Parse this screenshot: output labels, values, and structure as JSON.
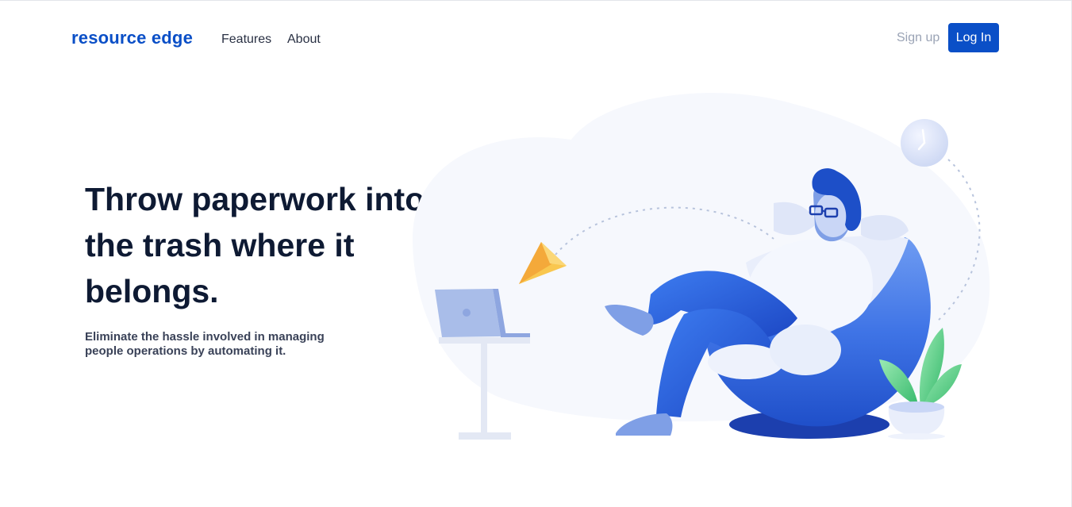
{
  "nav": {
    "brand": "resource edge",
    "links": [
      "Features",
      "About"
    ],
    "signup_label": "Sign up",
    "login_label": "Log In"
  },
  "hero": {
    "title": "Throw paperwork into the trash where it belongs.",
    "subtitle": "Eliminate the hassle involved in managing people operations by automating it."
  },
  "colors": {
    "brand": "#0a4fc7",
    "heading": "#0e1a33",
    "subtext": "#3a4258",
    "muted": "#9aa3b5"
  },
  "icons": [
    "clock-icon",
    "paper-plane-icon",
    "laptop-icon",
    "plant-icon"
  ]
}
